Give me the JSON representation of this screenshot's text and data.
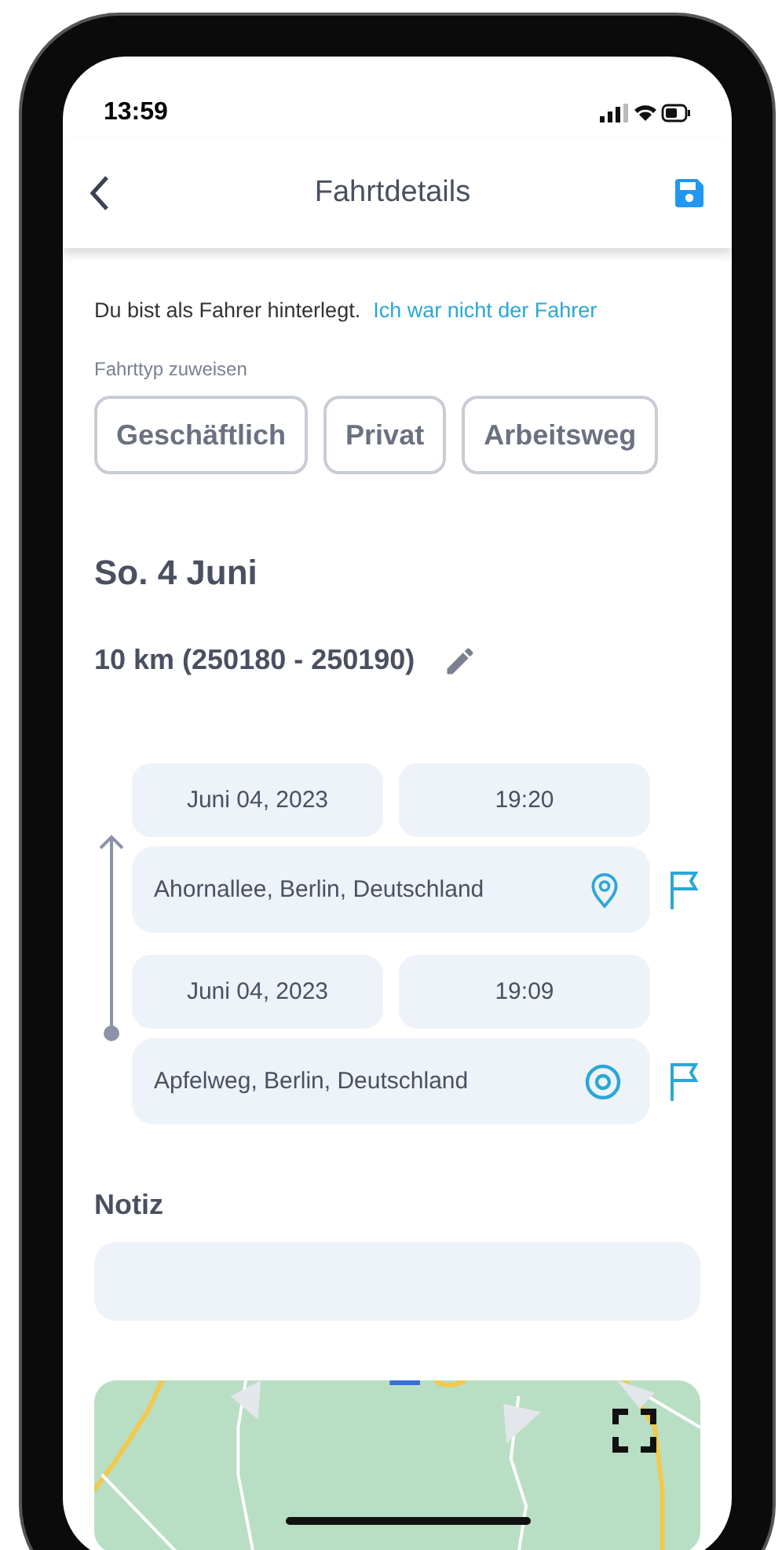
{
  "status_bar": {
    "time": "13:59"
  },
  "header": {
    "title": "Fahrtdetails"
  },
  "driver": {
    "text": "Du bist als Fahrer hinterlegt.",
    "link": "Ich war nicht der Fahrer"
  },
  "trip_type": {
    "label": "Fahrttyp zuweisen",
    "options": [
      {
        "label": "Geschäftlich",
        "selected": false
      },
      {
        "label": "Privat",
        "selected": false
      },
      {
        "label": "Arbeitsweg",
        "selected": false
      }
    ]
  },
  "day": "So. 4 Juni",
  "distance": "10 km (250180 - 250190)",
  "stops": [
    {
      "date": "Juni 04, 2023",
      "time": "19:20",
      "address": "Ahornallee, Berlin, Deutschland",
      "kind": "pin"
    },
    {
      "date": "Juni 04, 2023",
      "time": "19:09",
      "address": "Apfelweg, Berlin, Deutschland",
      "kind": "target"
    }
  ],
  "note": {
    "label": "Notiz"
  }
}
